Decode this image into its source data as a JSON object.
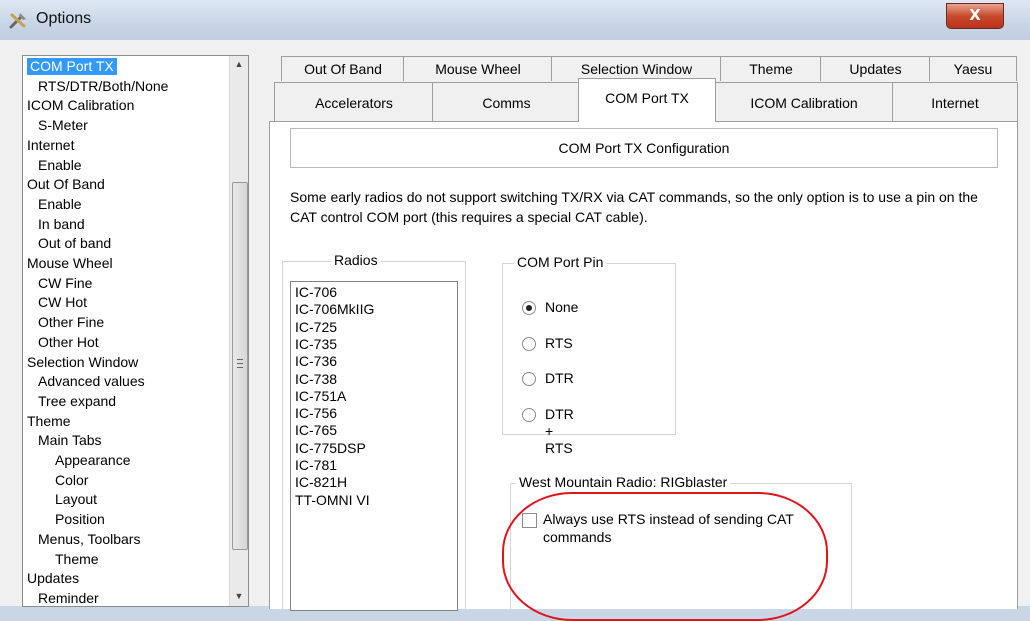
{
  "window": {
    "title": "Options",
    "close_glyph": "X"
  },
  "tree": {
    "items": [
      {
        "label": "COM Port TX",
        "indent": 0,
        "selected": true
      },
      {
        "label": "RTS/DTR/Both/None",
        "indent": 1
      },
      {
        "label": "ICOM Calibration",
        "indent": 0
      },
      {
        "label": "S-Meter",
        "indent": 1
      },
      {
        "label": "Internet",
        "indent": 0
      },
      {
        "label": "Enable",
        "indent": 1
      },
      {
        "label": "Out Of Band",
        "indent": 0
      },
      {
        "label": "Enable",
        "indent": 1
      },
      {
        "label": "In band",
        "indent": 1
      },
      {
        "label": "Out of band",
        "indent": 1
      },
      {
        "label": "Mouse Wheel",
        "indent": 0
      },
      {
        "label": "CW Fine",
        "indent": 1
      },
      {
        "label": "CW Hot",
        "indent": 1
      },
      {
        "label": "Other Fine",
        "indent": 1
      },
      {
        "label": "Other Hot",
        "indent": 1
      },
      {
        "label": "Selection Window",
        "indent": 0
      },
      {
        "label": "Advanced values",
        "indent": 1
      },
      {
        "label": "Tree expand",
        "indent": 1
      },
      {
        "label": "Theme",
        "indent": 0
      },
      {
        "label": "Main Tabs",
        "indent": 1
      },
      {
        "label": "Appearance",
        "indent": 2
      },
      {
        "label": "Color",
        "indent": 2
      },
      {
        "label": "Layout",
        "indent": 2
      },
      {
        "label": "Position",
        "indent": 2
      },
      {
        "label": "Menus, Toolbars",
        "indent": 1
      },
      {
        "label": "Theme",
        "indent": 2
      },
      {
        "label": "Updates",
        "indent": 0
      },
      {
        "label": "Reminder",
        "indent": 1
      }
    ]
  },
  "tabs": {
    "row1": [
      "Out Of Band",
      "Mouse Wheel",
      "Selection Window",
      "Theme",
      "Updates",
      "Yaesu"
    ],
    "row2": [
      "Accelerators",
      "Comms",
      "COM Port TX",
      "ICOM Calibration",
      "Internet"
    ],
    "active": "COM Port TX"
  },
  "panel": {
    "heading": "COM Port TX Configuration",
    "description": "Some early radios do not support switching TX/RX via CAT commands, so the only option is to use a pin on the CAT control COM port (this requires a special CAT cable).",
    "radios_group": {
      "title": "Radios",
      "items": [
        "IC-706",
        "IC-706MkIIG",
        "IC-725",
        "IC-735",
        "IC-736",
        "IC-738",
        "IC-751A",
        "IC-756",
        "IC-765",
        "IC-775DSP",
        "IC-781",
        "IC-821H",
        "TT-OMNI VI"
      ]
    },
    "pin_group": {
      "title": "COM Port Pin",
      "options": [
        "None",
        "RTS",
        "DTR",
        "DTR + RTS"
      ],
      "selected": "None"
    },
    "rig_group": {
      "title": "West Mountain Radio: RIGblaster",
      "checkbox_label": "Always use RTS instead of sending CAT commands",
      "checked": false
    }
  },
  "colors": {
    "selection": "#3399ff",
    "highlight_oval": "#e0141a"
  }
}
